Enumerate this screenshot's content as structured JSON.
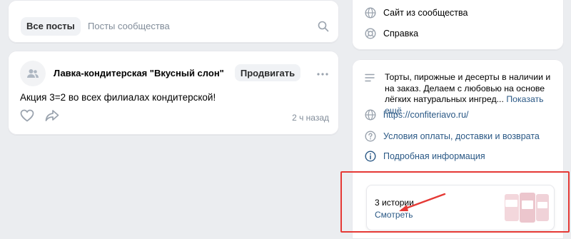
{
  "feed": {
    "tabs": [
      {
        "label": "Все посты",
        "active": true
      },
      {
        "label": "Посты сообщества",
        "active": false
      }
    ],
    "icons": {
      "search": "search-icon"
    }
  },
  "post": {
    "author": "Лавка-кондитерская \"Вкусный слон\"",
    "promote_label": "Продвигать",
    "text": "Акция 3=2 во всех филиалах кондитерской!",
    "time": "2 ч назад",
    "icons": {
      "avatar": "community-avatar-icon",
      "more": "more-icon",
      "like": "heart-icon",
      "share": "share-icon"
    }
  },
  "sidebar_links": [
    {
      "label": "Сайт из сообщества",
      "icon": "globe-icon"
    },
    {
      "label": "Справка",
      "icon": "lifebuoy-icon"
    }
  ],
  "info": {
    "description": "Торты, пирожные и десерты в наличии и на заказ. Делаем с любовью на основе лёгких натуральных ингред...",
    "show_more": "Показать ещё",
    "website": "https://confiteriavo.ru/",
    "terms": "Условия оплаты, доставки и возврата",
    "details": "Подробная информация"
  },
  "stories": {
    "title": "3 истории",
    "watch_label": "Смотреть"
  },
  "colors": {
    "background": "#ebedf0",
    "link": "#2a5885",
    "highlight": "#e53935",
    "muted": "#818c99"
  }
}
